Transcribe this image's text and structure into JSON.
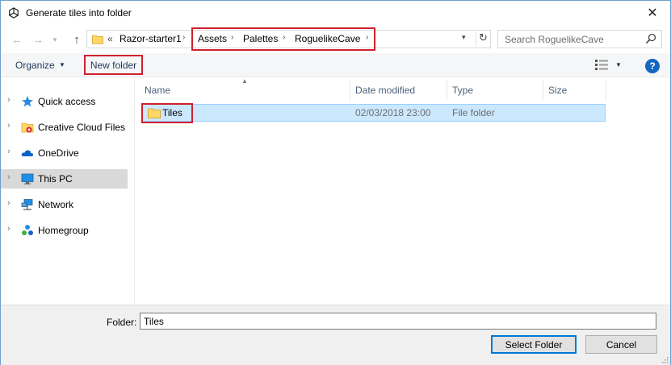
{
  "window": {
    "title": "Generate tiles into folder",
    "close_glyph": "✕"
  },
  "nav": {
    "back_glyph": "←",
    "forward_glyph": "→",
    "recent_glyph": "▾",
    "up_glyph": "↑",
    "overflow_glyph": "«",
    "crumbs": [
      "Razor-starter1",
      "Assets",
      "Palettes",
      "RoguelikeCave"
    ],
    "dropdown_glyph": "▾",
    "refresh_glyph": "↻",
    "search_placeholder": "Search RoguelikeCave"
  },
  "toolbar": {
    "organize_label": "Organize",
    "organize_caret": "▼",
    "new_folder_label": "New folder",
    "view_caret": "▼",
    "help_label": "?"
  },
  "sidebar": {
    "items": [
      {
        "label": "Quick access",
        "icon": "star-icon",
        "selected": false
      },
      {
        "label": "Creative Cloud Files",
        "icon": "creative-cloud-icon",
        "selected": false
      },
      {
        "label": "OneDrive",
        "icon": "cloud-icon",
        "selected": false
      },
      {
        "label": "This PC",
        "icon": "computer-icon",
        "selected": true
      },
      {
        "label": "Network",
        "icon": "network-icon",
        "selected": false
      },
      {
        "label": "Homegroup",
        "icon": "homegroup-icon",
        "selected": false
      }
    ]
  },
  "list": {
    "columns": [
      "Name",
      "Date modified",
      "Type",
      "Size"
    ],
    "rows": [
      {
        "name": "Tiles",
        "date": "02/03/2018 23:00",
        "type": "File folder",
        "size": ""
      }
    ]
  },
  "footer": {
    "folder_label": "Folder:",
    "folder_value": "Tiles",
    "select_label": "Select Folder",
    "cancel_label": "Cancel"
  },
  "colors": {
    "accent": "#0078d7",
    "highlight_red": "#d0202e",
    "selection": "#cce8ff"
  }
}
